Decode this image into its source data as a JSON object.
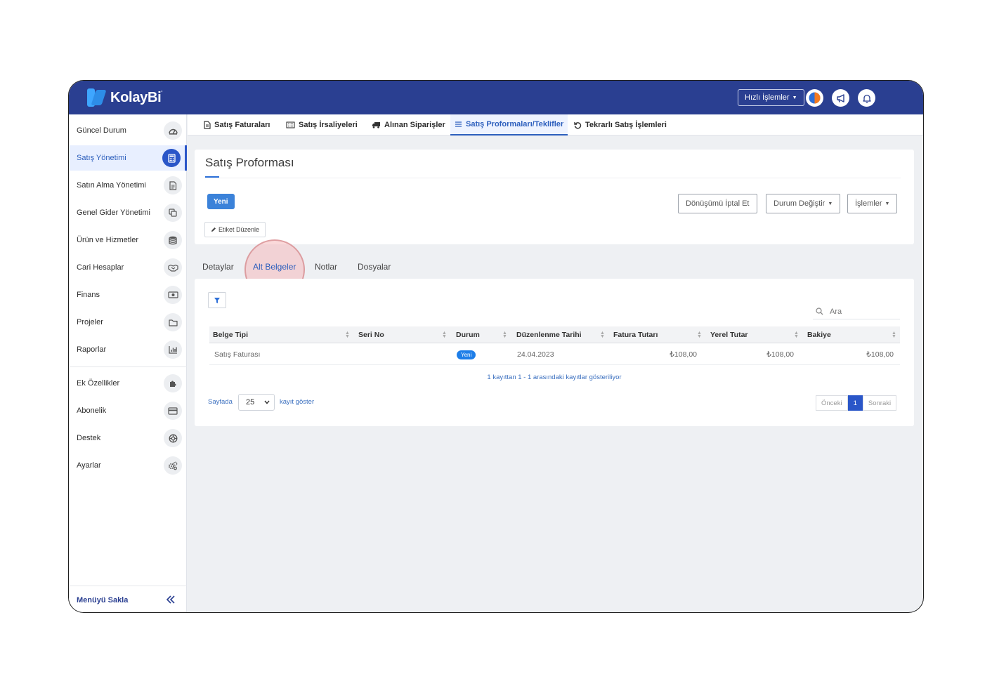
{
  "app": {
    "brand": "KolayBi",
    "brand_mark": "'",
    "quick_actions_label": "Hızlı İşlemler"
  },
  "sidebar": {
    "items": [
      {
        "label": "Güncel Durum",
        "icon": "dashboard-icon"
      },
      {
        "label": "Satış Yönetimi",
        "icon": "calculator-icon",
        "active": true
      },
      {
        "label": "Satın Alma Yönetimi",
        "icon": "document-icon"
      },
      {
        "label": "Genel Gider Yönetimi",
        "icon": "copy-icon"
      },
      {
        "label": "Ürün ve Hizmetler",
        "icon": "database-icon"
      },
      {
        "label": "Cari Hesaplar",
        "icon": "handshake-icon"
      },
      {
        "label": "Finans",
        "icon": "cash-icon"
      },
      {
        "label": "Projeler",
        "icon": "folder-icon"
      },
      {
        "label": "Raporlar",
        "icon": "bar-chart-icon"
      },
      {
        "label": "Ek Özellikler",
        "icon": "puzzle-icon"
      },
      {
        "label": "Abonelik",
        "icon": "credit-card-icon"
      },
      {
        "label": "Destek",
        "icon": "lifebuoy-icon"
      },
      {
        "label": "Ayarlar",
        "icon": "gears-icon"
      }
    ],
    "collapse_label": "Menüyü Sakla"
  },
  "top_tabs": [
    {
      "label": "Satış Faturaları",
      "icon": "file-icon"
    },
    {
      "label": "Satış İrsaliyeleri",
      "icon": "list-card-icon"
    },
    {
      "label": "Alınan Siparişler",
      "icon": "truck-icon"
    },
    {
      "label": "Satış Proformaları/Teklifler",
      "icon": "menu-lines-icon",
      "active": true
    },
    {
      "label": "Tekrarlı Satış İşlemleri",
      "icon": "repeat-icon"
    }
  ],
  "page": {
    "title": "Satış Proforması",
    "new_label": "Yeni",
    "edit_tag_label": "Etiket Düzenle",
    "cancel_conversion_label": "Dönüşümü İptal Et",
    "change_status_label": "Durum Değiştir",
    "actions_label": "İşlemler"
  },
  "sub_tabs": [
    {
      "label": "Detaylar"
    },
    {
      "label": "Alt Belgeler",
      "active": true
    },
    {
      "label": "Notlar"
    },
    {
      "label": "Dosyalar"
    }
  ],
  "table": {
    "search_placeholder": "Ara",
    "columns": [
      "Belge Tipi",
      "Seri No",
      "Durum",
      "Düzenlenme Tarihi",
      "Fatura Tutarı",
      "Yerel Tutar",
      "Bakiye"
    ],
    "rows": [
      {
        "type": "Satış Faturası",
        "serial": "",
        "status": "Yeni",
        "date": "24.04.2023",
        "invoice_amount": "₺108,00",
        "local_amount": "₺108,00",
        "balance": "₺108,00"
      }
    ],
    "info": "1 kayıttan 1 - 1 arasındaki kayıtlar gösteriliyor",
    "page_size_prefix": "Sayfada",
    "page_size": "25",
    "page_size_suffix": "kayıt göster",
    "pager": {
      "prev": "Önceki",
      "current": "1",
      "next": "Sonraki"
    }
  },
  "colors": {
    "topbar": "#2a3f91",
    "accent": "#2a56c8",
    "primary_button": "#3b82d9",
    "badge": "#1e7ee8"
  }
}
